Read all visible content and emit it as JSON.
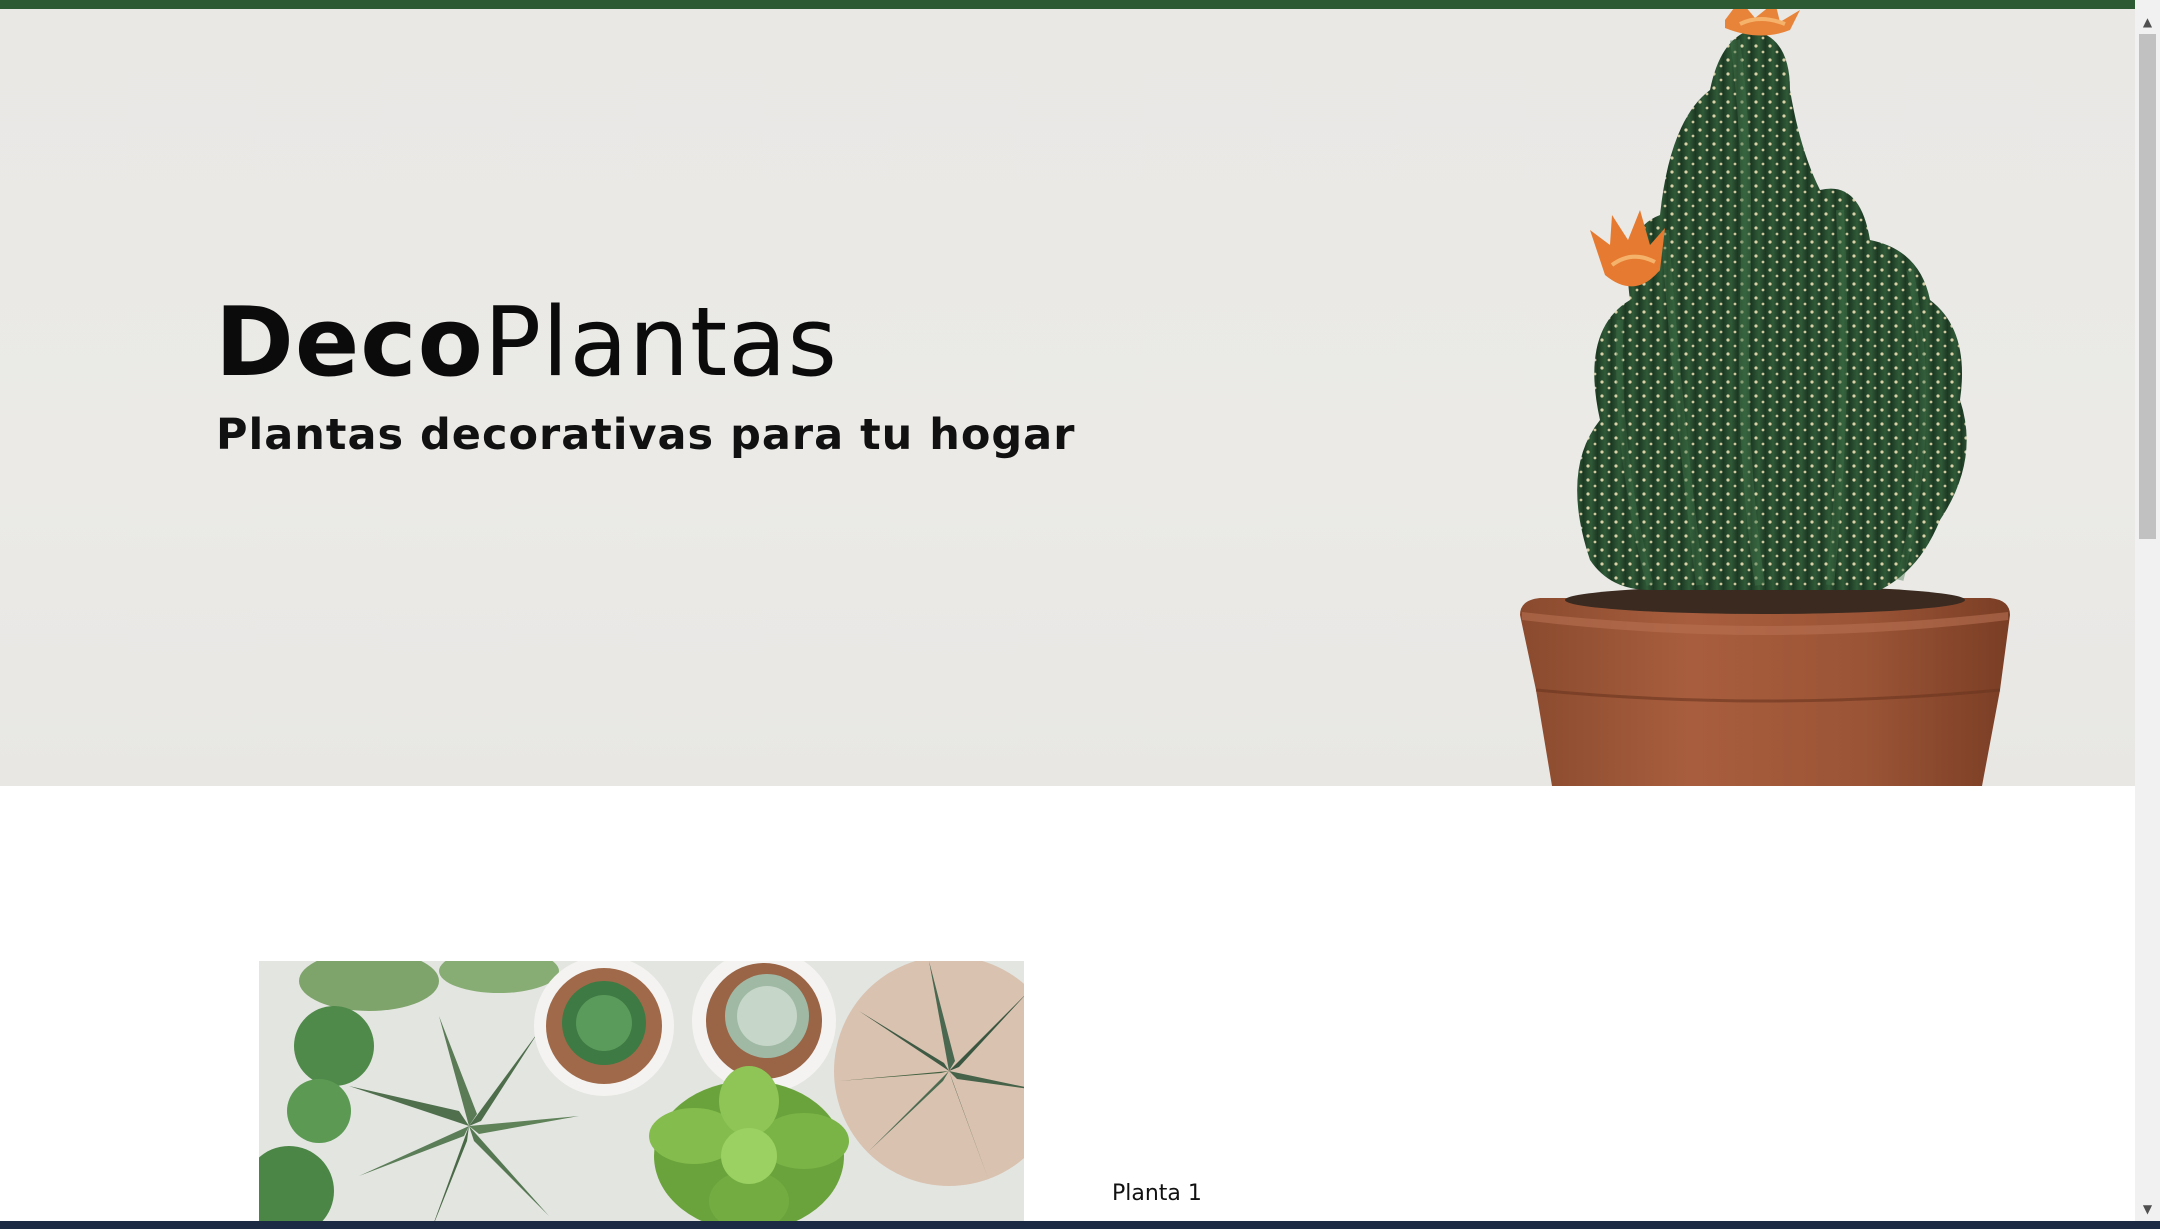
{
  "colors": {
    "top_bar": "#2d5a32",
    "hero_background": "#e9e8e5",
    "text": "#0b0b0b",
    "taskbar": "#1c2a44"
  },
  "hero": {
    "title_bold": "Deco",
    "title_regular": "Plantas",
    "subtitle": "Plantas decorativas para tu hogar"
  },
  "products": [
    {
      "label": "Planta 1",
      "image": "succulents-top-view-image"
    }
  ],
  "icons": {
    "scroll_up": "chevron-up-icon",
    "scroll_down": "chevron-down-icon",
    "hero_image": "potted-cactus-image"
  }
}
